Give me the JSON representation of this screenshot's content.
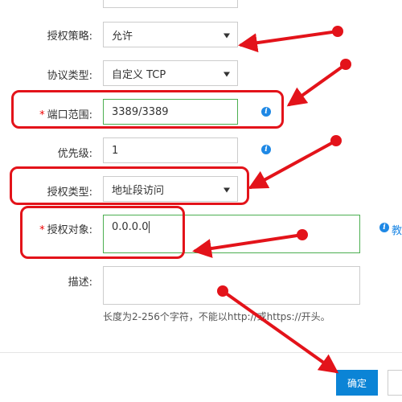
{
  "form": {
    "policy": {
      "label": "授权策略:",
      "value": "允许"
    },
    "protocol": {
      "label": "协议类型:",
      "value": "自定义 TCP"
    },
    "port": {
      "required_mark": "*",
      "label": "端口范围:",
      "value": "3389/3389",
      "info_glyph": "i"
    },
    "priority": {
      "label": "优先级:",
      "value": "1",
      "info_glyph": "i"
    },
    "auth_type": {
      "label": "授权类型:",
      "value": "地址段访问"
    },
    "auth_object": {
      "required_mark": "*",
      "label": "授权对象:",
      "value": "0.0.0.0",
      "side_text": "教"
    },
    "description": {
      "label": "描述:",
      "value": "",
      "hint": "长度为2-256个字符，不能以http://或https://开头。"
    }
  },
  "footer": {
    "confirm_label": "确定"
  },
  "icons": {
    "info": "info-icon",
    "caret": "chevron-down-icon"
  },
  "colors": {
    "annotation": "#e3131a",
    "primary": "#0b84d6",
    "focus_border": "#4caf50",
    "info": "#1e88e5"
  }
}
